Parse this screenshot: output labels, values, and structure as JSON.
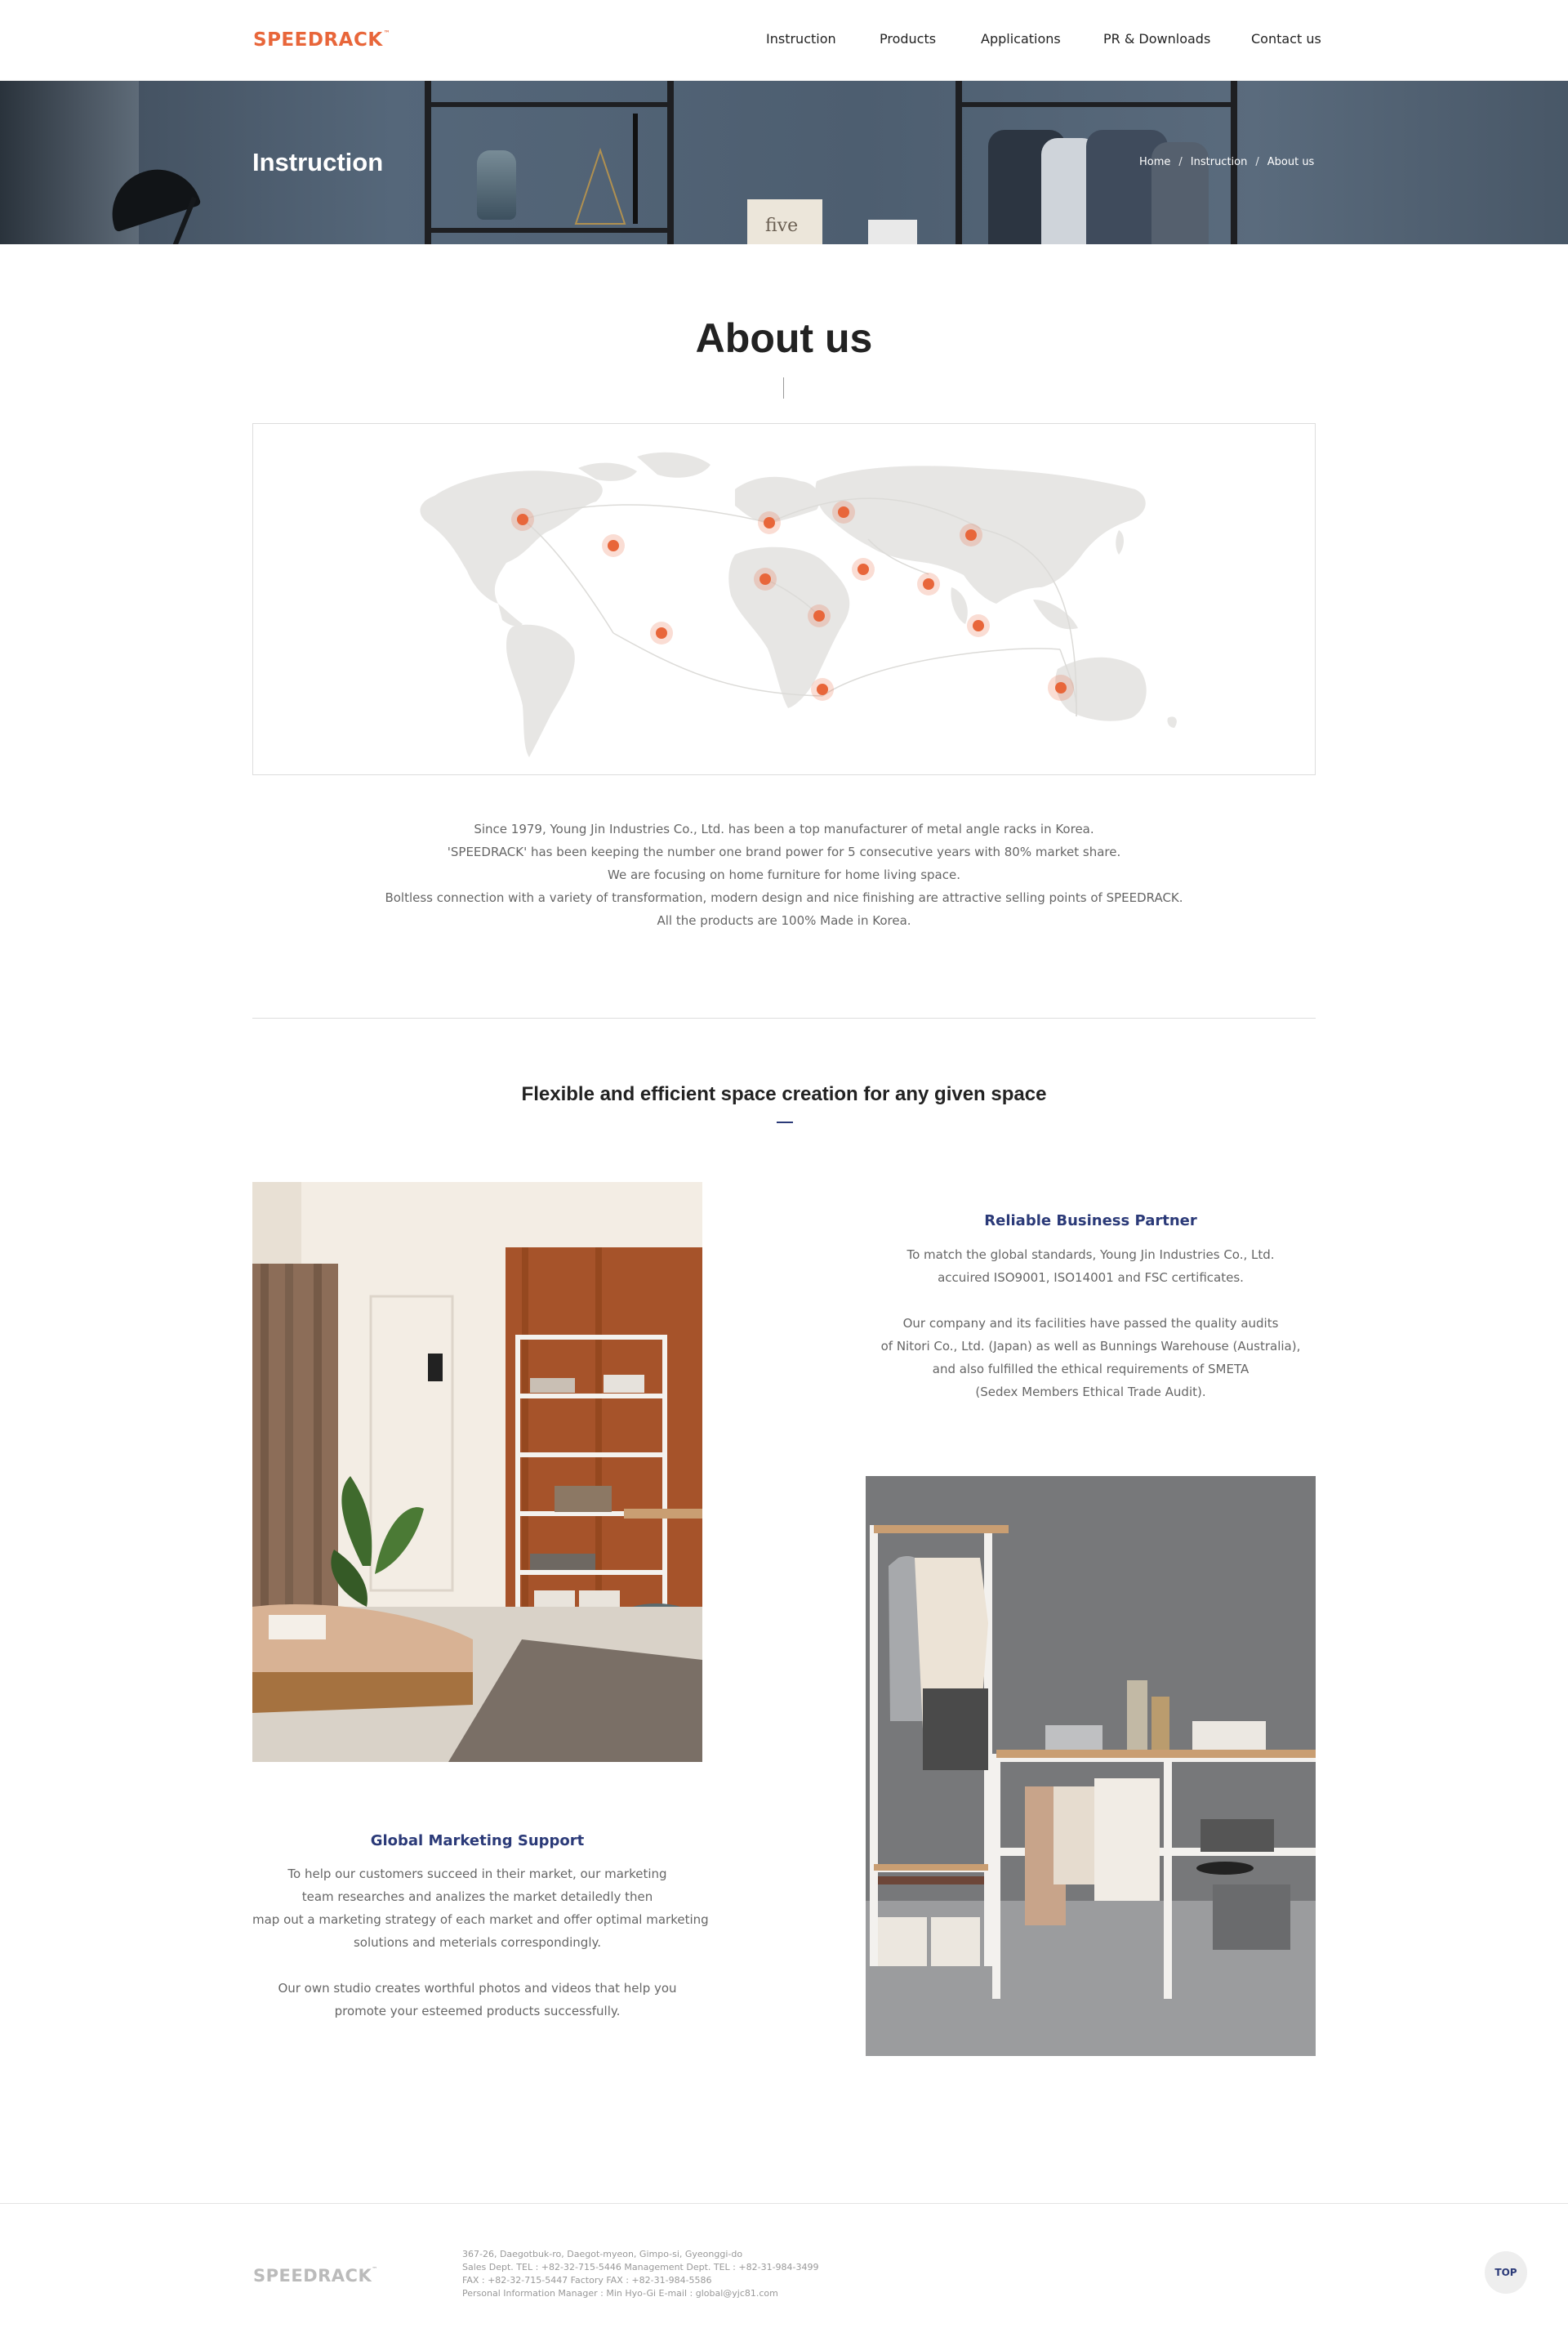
{
  "header": {
    "logo": "SPEEDRACK",
    "logo_tm": "™",
    "nav": [
      "Instruction",
      "Products",
      "Applications",
      "PR & Downloads",
      "Contact us"
    ]
  },
  "banner": {
    "title": "Instruction",
    "card_text": "five",
    "breadcrumb": [
      "Home",
      "Instruction",
      "About us"
    ],
    "breadcrumb_sep": "/"
  },
  "about": {
    "title": "About us",
    "paragraph": [
      "Since 1979, Young Jin Industries Co., Ltd. has been a top manufacturer of metal angle racks in Korea.",
      "'SPEEDRACK' has been keeping the number one brand power for 5 consecutive years with 80% market share.",
      "We are focusing on home furniture for home living space.",
      "Boltless connection with a variety of transformation, modern design and nice finishing are attractive selling points of SPEEDRACK.",
      "All the products are 100% Made in Korea."
    ]
  },
  "space_section": {
    "title": "Flexible and efficient space creation for any given space",
    "reliable": {
      "heading": "Reliable Business Partner",
      "lines": [
        "To match the global standards, Young Jin Industries Co., Ltd.",
        "accuired ISO9001, ISO14001 and FSC certificates.",
        "",
        "Our company and its facilities have passed the quality audits",
        "of Nitori Co., Ltd. (Japan) as well as Bunnings Warehouse (Australia),",
        "and also fulfilled the ethical requirements of SMETA",
        "(Sedex Members Ethical Trade Audit)."
      ]
    },
    "marketing": {
      "heading": "Global Marketing Support",
      "lines": [
        "To help our customers succeed in their market, our marketing",
        "team researches and analizes the market detailedly then",
        "map out a marketing strategy of each market and offer optimal marketing",
        "solutions and meterials correspondingly.",
        "",
        "Our own studio creates worthful photos and videos that help you",
        "promote your esteemed products successfully."
      ]
    }
  },
  "footer": {
    "logo": "SPEEDRACK",
    "logo_tm": "™",
    "lines": [
      "367-26, Daegotbuk-ro, Daegot-myeon, Gimpo-si, Gyeonggi-do",
      "Sales Dept. TEL : +82-32-715-5446   Management Dept. TEL : +82-31-984-3499",
      "FAX : +82-32-715-5447   Factory FAX : +82-31-984-5586",
      "Personal Information Manager : Min Hyo-Gi   E-mail : global@yjc81.com"
    ],
    "top_label": "TOP"
  },
  "colors": {
    "brand_orange": "#e8663a",
    "accent_navy": "#2b3a78",
    "map_land": "#e7e6e4",
    "map_dot": "#e8663a"
  }
}
